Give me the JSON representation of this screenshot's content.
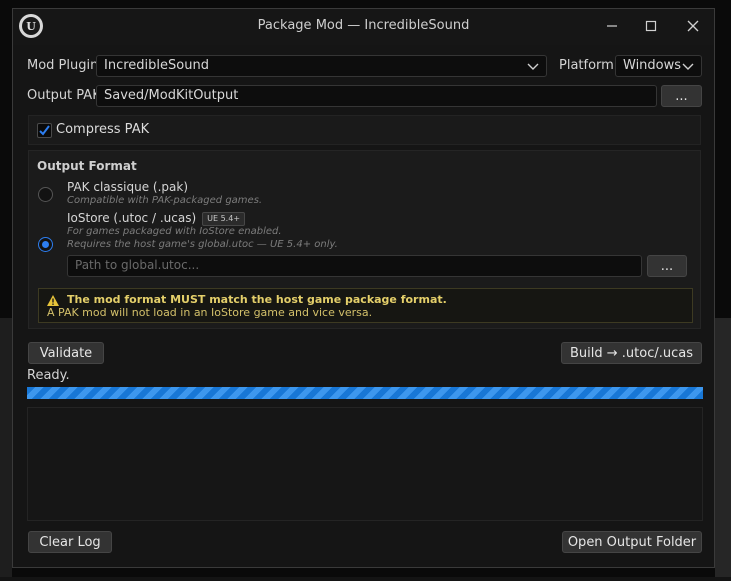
{
  "window": {
    "title": "Package Mod — IncredibleSound"
  },
  "mod_plugin": {
    "label": "Mod Plugin",
    "value": "IncredibleSound"
  },
  "platform": {
    "label": "Platform",
    "value": "Windows"
  },
  "output_pak": {
    "label": "Output PAK",
    "value": "Saved/ModKitOutput",
    "browse_label": "..."
  },
  "compress": {
    "label": "Compress PAK",
    "checked": true
  },
  "output_format": {
    "title": "Output Format",
    "options": [
      {
        "title": "PAK classique (.pak)",
        "sub1": "Compatible with PAK-packaged games.",
        "selected": false
      },
      {
        "title": "IoStore (.utoc / .ucas)",
        "badge": "UE 5.4+",
        "sub1": "For games packaged with IoStore enabled.",
        "sub2": "Requires the host game's global.utoc — UE 5.4+ only.",
        "selected": true
      }
    ],
    "global_utoc_placeholder": "Path to global.utoc...",
    "global_utoc_browse_label": "..."
  },
  "warning": {
    "title": "The mod format MUST match the host game package format.",
    "body": "A PAK mod will not load in an IoStore game and vice versa."
  },
  "actions": {
    "validate_label": "Validate",
    "build_label": "Build → .utoc/.ucas"
  },
  "status": {
    "text": "Ready.",
    "progress_percent": 100
  },
  "log": {
    "clear_label": "Clear Log",
    "open_folder_label": "Open Output Folder"
  },
  "colors": {
    "accent": "#2d7ef0",
    "warning_text": "#e4cf6a",
    "window_bg": "#151515"
  }
}
